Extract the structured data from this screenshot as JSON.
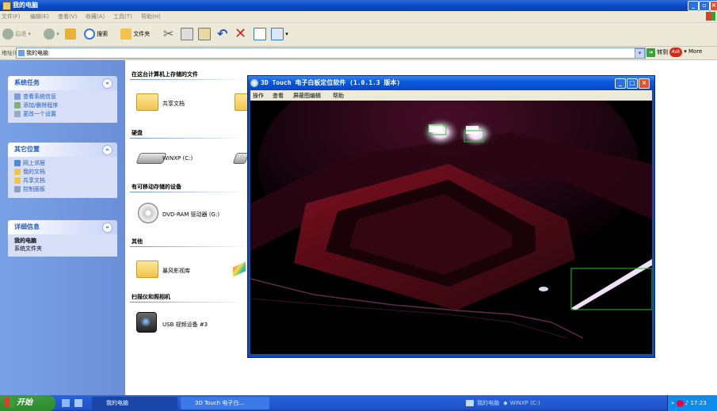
{
  "explorer": {
    "title": "我的电脑",
    "menu": [
      "文件(F)",
      "编辑(E)",
      "查看(V)",
      "收藏(A)",
      "工具(T)",
      "帮助(H)"
    ],
    "toolbar": {
      "back": "后退",
      "search": "搜索",
      "folders": "文件夹"
    },
    "address": {
      "label": "地址(D)",
      "value": "我的电脑",
      "go": "转到",
      "ask_more": "More"
    },
    "left_pane": {
      "system_tasks": {
        "title": "系统任务",
        "items": [
          "查看系统信息",
          "添加/删除程序",
          "更改一个设置"
        ]
      },
      "other_places": {
        "title": "其它位置",
        "items": [
          "网上邻居",
          "我的文档",
          "共享文档",
          "控制面板"
        ]
      },
      "details": {
        "title": "详细信息",
        "name": "我的电脑",
        "desc": "系统文件夹"
      }
    },
    "groups": {
      "stored_files": "在这台计算机上存储的文件",
      "hard_disks": "硬盘",
      "removable": "有可移动存储的设备",
      "other": "其他",
      "scanners": "扫描仪和照相机"
    },
    "items": {
      "shared_docs": "共享文档",
      "drive_c": "WINXP (C:)",
      "dvd": "DVD-RAM 驱动器 (G:)",
      "storm": "暴风影视库",
      "usb_video": "USB 视频设备 #3"
    }
  },
  "app": {
    "title": "3D Touch 电子白板定位软件 (1.0.1.3 版本)",
    "menu": [
      "操作",
      "查看",
      "屏蔽图编辑",
      "帮助"
    ]
  },
  "taskbar": {
    "start": "开始",
    "tasks": [
      "我的电脑",
      "3D Touch 电子白..."
    ],
    "status_items": [
      "我的电脑",
      "WINXP (C:)"
    ],
    "clock": "17:23"
  },
  "colors": {
    "xp_blue": "#0a4bc8",
    "panel_blue": "#6b8fd8",
    "close_red": "#e0502a",
    "detect_green": "#22c03a"
  }
}
